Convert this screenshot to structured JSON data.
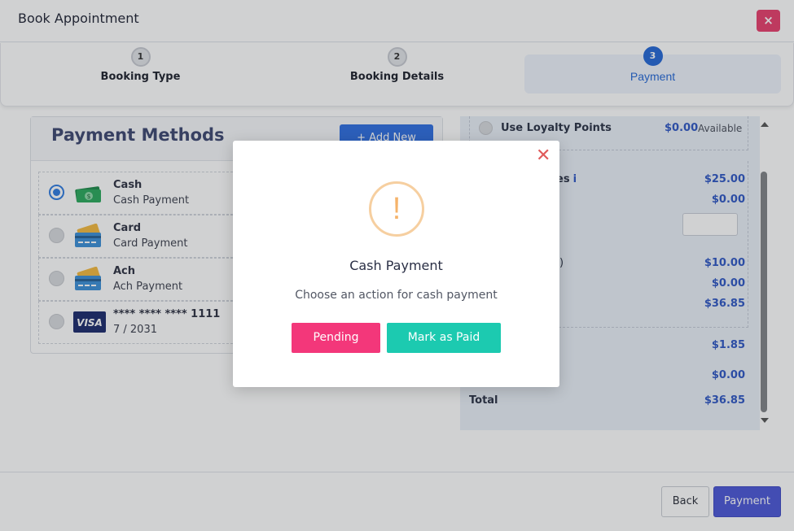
{
  "header": {
    "title": "Book Appointment",
    "close_label": "×"
  },
  "stepper": {
    "steps": [
      {
        "number": "1",
        "label": "Booking Type"
      },
      {
        "number": "2",
        "label": "Booking Details"
      },
      {
        "number": "3",
        "label": "Payment"
      }
    ]
  },
  "payment_methods": {
    "title": "Payment Methods",
    "add_button": "+ Add New",
    "items": [
      {
        "name": "Cash",
        "sub": "Cash Payment",
        "icon": "cash-icon"
      },
      {
        "name": "Card",
        "sub": "Card Payment",
        "icon": "card-icon"
      },
      {
        "name": "Ach",
        "sub": "Ach Payment",
        "icon": "ach-icon"
      },
      {
        "name": "**** **** **** 1111",
        "sub": "7 / 2031",
        "icon": "visa-icon"
      }
    ]
  },
  "summary": {
    "loyalty_label": "Use Loyalty Points",
    "loyalty_value": "$0.00",
    "loyalty_available": "Available",
    "rows": [
      {
        "label": "es",
        "value": "$25.00"
      },
      {
        "label": "",
        "value": "$0.00"
      },
      {
        "label": ")",
        "value": "$10.00"
      },
      {
        "label": "",
        "value": "$0.00"
      },
      {
        "label": "",
        "value": "$36.85"
      },
      {
        "label": "",
        "value": "$1.85"
      },
      {
        "label": "",
        "value": "$0.00"
      }
    ],
    "info_mark": "i",
    "total_label": "Total",
    "total_value": "$36.85"
  },
  "footer": {
    "back_label": "Back",
    "payment_label": "Payment"
  },
  "dialog": {
    "close_label": "✕",
    "warning_mark": "!",
    "title": "Cash Payment",
    "message": "Choose an action for cash payment",
    "pending_label": "Pending",
    "paid_label": "Mark as Paid"
  },
  "colors": {
    "accent": "#2367d6",
    "pending": "#f3377a",
    "paid": "#1ccab0",
    "close": "#e83e6c"
  }
}
